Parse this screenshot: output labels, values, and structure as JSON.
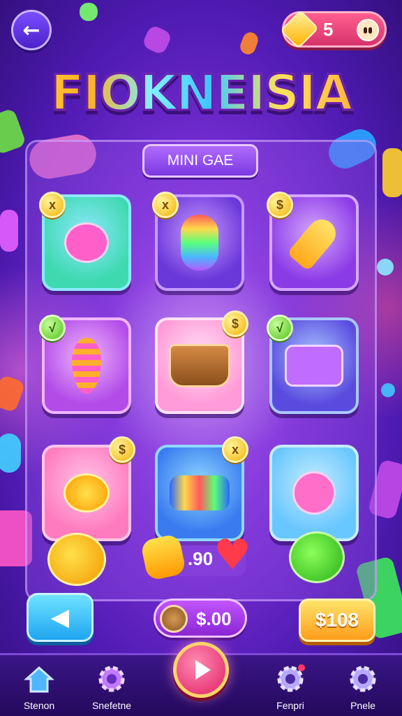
{
  "header": {
    "title": "FIOKNEISIA",
    "coin_count": "5",
    "back_icon": "back-arrow-icon"
  },
  "board": {
    "label": "MINI GAE",
    "mid_counter": ".90",
    "tiles": [
      {
        "name": "pink-cat-game",
        "badge": "x",
        "badge_style": "gold",
        "bg": "#3fd9b0",
        "border": "#8ee8ff"
      },
      {
        "name": "rainbow-worm-game",
        "badge": "x",
        "badge_style": "gold",
        "bg": "#6a37d9",
        "border": "#c79bff"
      },
      {
        "name": "rocket-game",
        "badge": "$",
        "badge_style": "gold",
        "bg": "#8b3be6",
        "border": "#d6a8ff"
      },
      {
        "name": "candy-drop-game",
        "badge": "√",
        "badge_style": "green",
        "bg": "#b24be8",
        "border": "#f0b6ff"
      },
      {
        "name": "dino-pot-game",
        "badge": "$",
        "badge_style": "gold",
        "bg": "#ff9bd8",
        "border": "#ffe2f5"
      },
      {
        "name": "arcade-machine-game",
        "badge": "√",
        "badge_style": "green",
        "bg": "#5a4bdf",
        "border": "#a9c8ff"
      },
      {
        "name": "goldfish-game",
        "badge": "$",
        "badge_style": "gold",
        "bg": "#ff7bc0",
        "border": "#ffc6e8"
      },
      {
        "name": "candy-roll-game",
        "badge": "x",
        "badge_style": "gold",
        "bg": "#3a7cf0",
        "border": "#8ed9ff"
      },
      {
        "name": "pink-monster-game",
        "badge": "",
        "badge_style": "none",
        "bg": "#69c7ff",
        "border": "#c6ecff"
      }
    ]
  },
  "actions": {
    "price": "$.00",
    "buy_label": "$108"
  },
  "nav": {
    "items": [
      {
        "label": "Stenon",
        "icon": "home-icon"
      },
      {
        "label": "Snefetne",
        "icon": "gear-icon"
      },
      {
        "label": "Fenpri",
        "icon": "gear-icon"
      },
      {
        "label": "Pnele",
        "icon": "gear-icon"
      }
    ],
    "play_icon": "play-icon"
  },
  "colors": {
    "accent": "#ffd36a",
    "brand": "#7a2fd6"
  }
}
